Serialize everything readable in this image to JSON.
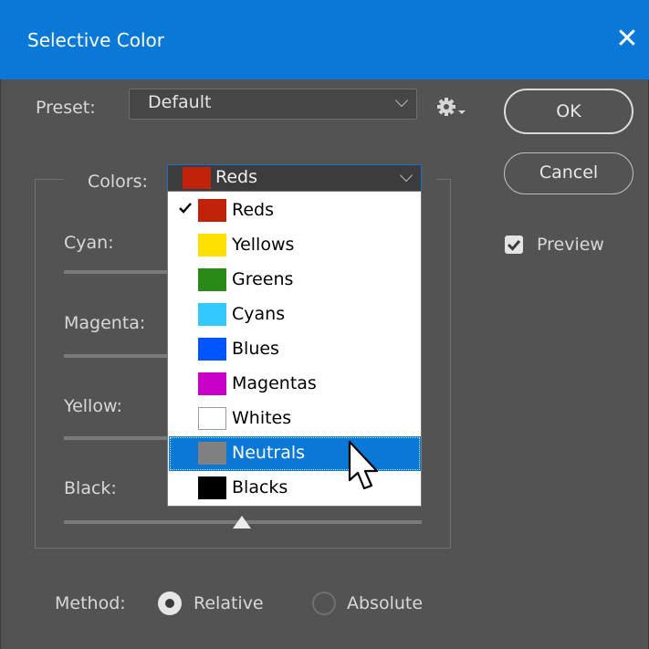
{
  "window": {
    "title": "Selective Color",
    "close_icon": "close-icon"
  },
  "preset": {
    "label": "Preset:",
    "value": "Default",
    "settings_icon": "gear-icon"
  },
  "buttons": {
    "ok": "OK",
    "cancel": "Cancel"
  },
  "preview": {
    "label": "Preview",
    "checked": true
  },
  "colors": {
    "label": "Colors:",
    "selected": "Reds",
    "selected_color": "#c0230a",
    "options": [
      {
        "label": "Reds",
        "color": "#c0230a",
        "checked": true
      },
      {
        "label": "Yellows",
        "color": "#ffe000"
      },
      {
        "label": "Greens",
        "color": "#2a8a17"
      },
      {
        "label": "Cyans",
        "color": "#33c8ff"
      },
      {
        "label": "Blues",
        "color": "#0055ff"
      },
      {
        "label": "Magentas",
        "color": "#c800c8"
      },
      {
        "label": "Whites",
        "color": "#ffffff"
      },
      {
        "label": "Neutrals",
        "color": "#808080",
        "highlighted": true
      },
      {
        "label": "Blacks",
        "color": "#000000"
      }
    ]
  },
  "sliders": [
    {
      "label": "Cyan:"
    },
    {
      "label": "Magenta:"
    },
    {
      "label": "Yellow:"
    },
    {
      "label": "Black:"
    }
  ],
  "method": {
    "label": "Method:",
    "relative": "Relative",
    "absolute": "Absolute",
    "selected": "Relative"
  },
  "theme": {
    "background": "#535353",
    "accent": "#0a78d7"
  }
}
